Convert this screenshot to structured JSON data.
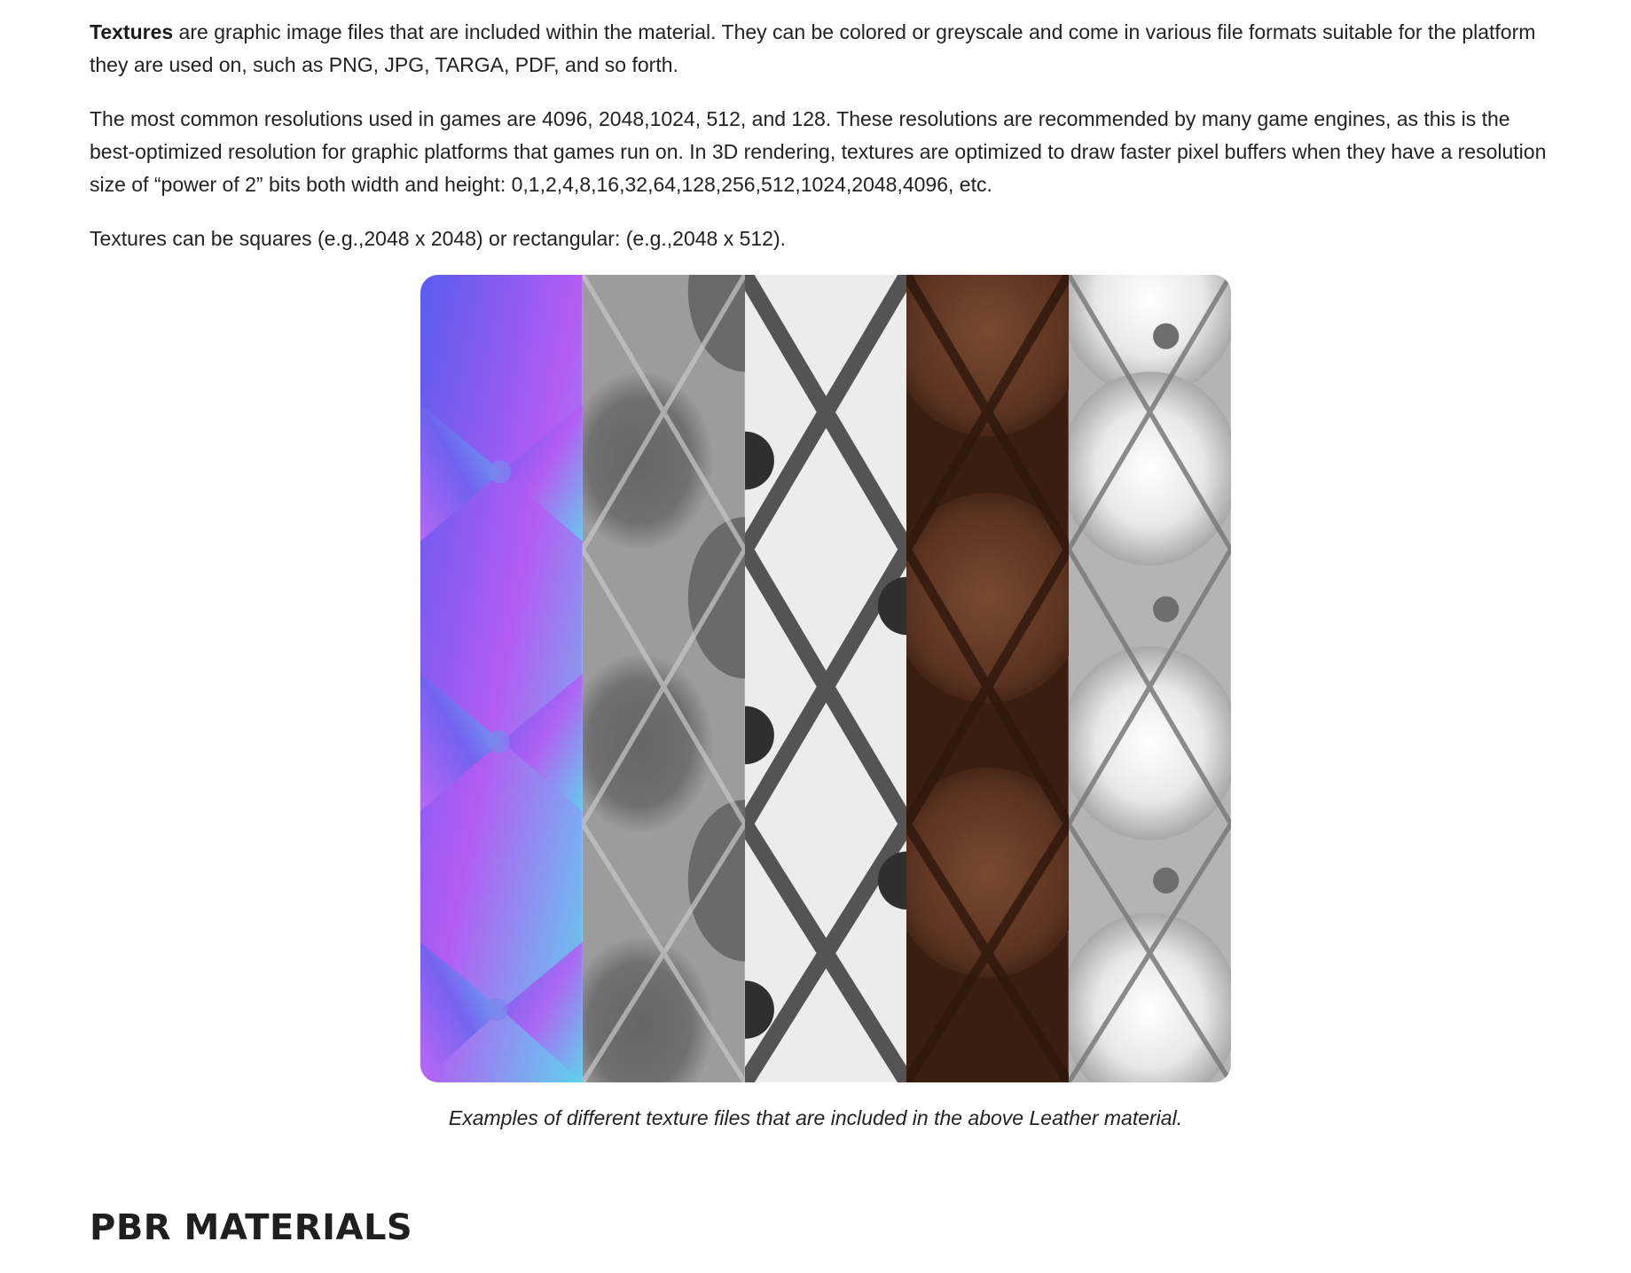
{
  "article": {
    "p1_bold": "Textures",
    "p1_rest": " are graphic image files that are included within the material. They can be colored or greyscale and come in various file formats suitable for the platform they are used on, such as PNG, JPG, TARGA, PDF, and so forth.",
    "p2": "The most common resolutions used in games are 4096, 2048,1024, 512, and 128. These resolutions are recommended by many game engines, as this is the best-optimized resolution for graphic platforms that games run on. In 3D rendering, textures are optimized to draw faster pixel buffers when they have a resolution size of “power of 2” bits both width and height: 0,1,2,4,8,16,32,64,128,256,512,1024,2048,4096, etc.",
    "p3": "Textures can be squares (e.g.,2048 x 2048) or rectangular: (e.g.,2048 x 512)."
  },
  "figure": {
    "caption": "Examples of different texture files that are included in the above Leather material.",
    "strips": [
      {
        "map": "normal-map",
        "colors": [
          "#5a5cf0",
          "#b35cf2",
          "#5fd2ee"
        ]
      },
      {
        "map": "roughness-map",
        "colors": [
          "#6a6a6a",
          "#b8b8b8",
          "#d0d0d0"
        ]
      },
      {
        "map": "ambient-occlusion-map",
        "colors": [
          "#e6e6e6",
          "#3a3a3a",
          "#f4f4f4"
        ]
      },
      {
        "map": "albedo-map",
        "colors": [
          "#3a1e12",
          "#7a4a30",
          "#55301e"
        ]
      },
      {
        "map": "height-map",
        "colors": [
          "#ffffff",
          "#6e6e6e",
          "#cfcfcf"
        ]
      }
    ]
  },
  "section": {
    "heading": "PBR MATERIALS"
  }
}
